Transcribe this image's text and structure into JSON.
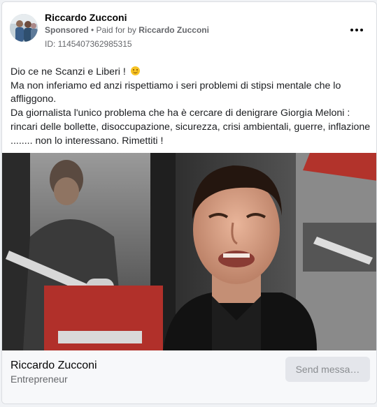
{
  "post": {
    "page_name": "Riccardo Zucconi",
    "sponsored_label": "Sponsored",
    "separator": " • ",
    "paid_for_prefix": "Paid for by ",
    "paid_for_name": "Riccardo Zucconi",
    "ad_id": "ID: 1145407362985315",
    "more_icon": "more-horizontal-icon",
    "body_lines": [
      "Dio ce ne Scanzi e Liberi ! ",
      "Ma non inferiamo ed anzi rispettiamo i seri problemi di stipsi mentale che lo",
      "affliggono.",
      "Da giornalista l'unico problema che ha è cercare di denigrare Giorgia Meloni :",
      "rincari delle bollette, disoccupazione, sicurezza, crisi ambientali, guerre, inflazione",
      "........ non lo interessano. Rimettiti !"
    ],
    "emoji_icon": "smiling-face-icon"
  },
  "footer": {
    "name": "Riccardo Zucconi",
    "subtitle": "Entrepreneur",
    "send_button_label": "Send messa…"
  },
  "colors": {
    "text_primary": "#050505",
    "text_secondary": "#65676b",
    "button_bg": "#e4e6eb",
    "card_border": "#dadde1"
  }
}
